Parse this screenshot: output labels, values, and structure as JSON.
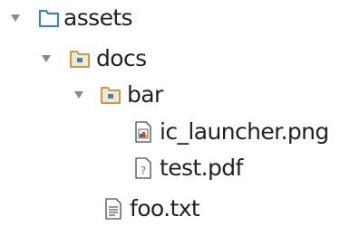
{
  "tree": [
    {
      "label": "assets",
      "kind": "folder",
      "expanded": true,
      "icon": "blue-folder-icon"
    },
    {
      "label": "docs",
      "kind": "folder",
      "expanded": true,
      "icon": "package-folder-icon"
    },
    {
      "label": "bar",
      "kind": "folder",
      "expanded": true,
      "icon": "package-folder-icon"
    },
    {
      "label": "ic_launcher.png",
      "kind": "file",
      "icon": "image-file-icon"
    },
    {
      "label": "test.pdf",
      "kind": "file",
      "icon": "unknown-file-icon"
    },
    {
      "label": "foo.txt",
      "kind": "file",
      "icon": "text-file-icon"
    }
  ],
  "colors": {
    "text": "#222222",
    "arrow": "#8a8a8a",
    "root_folder": "#3d85b8",
    "package_folder": "#c79a4c",
    "file_outline": "#6b6b6b"
  }
}
